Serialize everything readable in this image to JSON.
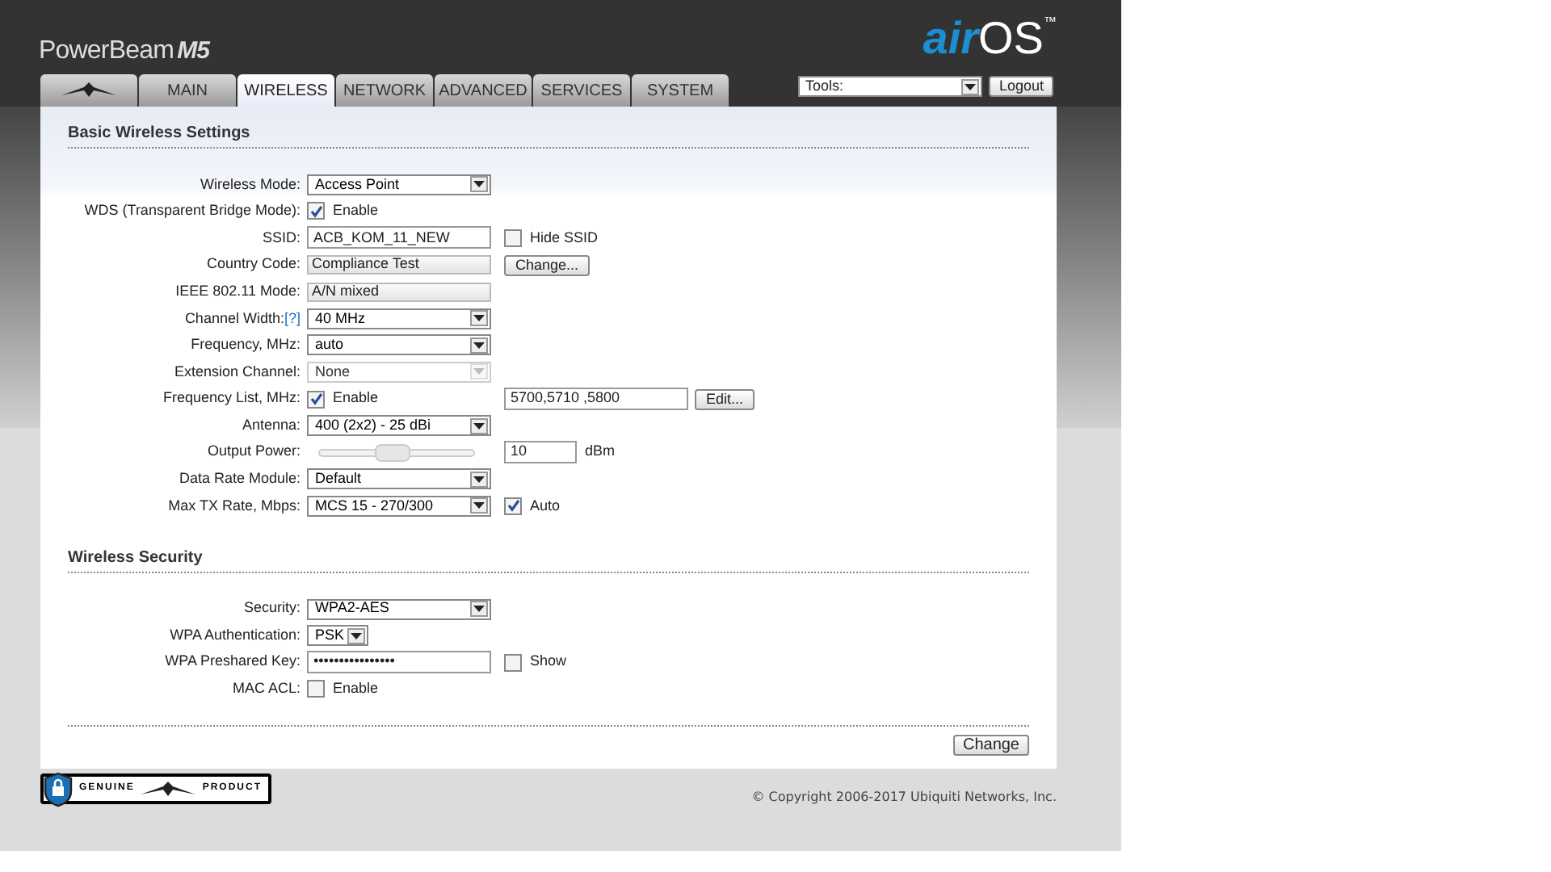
{
  "header": {
    "product": "PowerBeam",
    "model": "M5",
    "brand_left": "air",
    "brand_right": "OS",
    "tm": "™"
  },
  "tabs": [
    {
      "kind": "logo",
      "selected": false
    },
    {
      "label": "MAIN",
      "selected": false
    },
    {
      "label": "WIRELESS",
      "selected": true
    },
    {
      "label": "NETWORK",
      "selected": false
    },
    {
      "label": "ADVANCED",
      "selected": false
    },
    {
      "label": "SERVICES",
      "selected": false
    },
    {
      "label": "SYSTEM",
      "selected": false
    }
  ],
  "tools": {
    "value": "Tools:"
  },
  "logout": "Logout",
  "sections": [
    {
      "title": "Basic Wireless Settings",
      "rows": [
        {
          "label": "Wireless Mode:",
          "controls": [
            {
              "kind": "select",
              "value": "Access Point",
              "disabled": false
            }
          ]
        },
        {
          "label": "WDS (Transparent Bridge Mode):",
          "controls": [
            {
              "kind": "checkbox",
              "label": "Enable",
              "checked": true
            }
          ]
        },
        {
          "label": "SSID:",
          "controls": [
            {
              "kind": "text",
              "value": "ACB_KOM_11_NEW"
            },
            {
              "kind": "checkbox",
              "label": "Hide SSID",
              "checked": false
            }
          ]
        },
        {
          "label": "Country Code:",
          "controls": [
            {
              "kind": "readonly",
              "value": "Compliance Test"
            },
            {
              "kind": "button",
              "label": "Change..."
            }
          ]
        },
        {
          "label": "IEEE 802.11 Mode:",
          "controls": [
            {
              "kind": "readonly",
              "value": "A/N mixed"
            }
          ]
        },
        {
          "label": "Channel Width:",
          "help": "[?]",
          "controls": [
            {
              "kind": "select",
              "value": "40 MHz",
              "disabled": false
            }
          ]
        },
        {
          "label": "Frequency, MHz:",
          "controls": [
            {
              "kind": "select",
              "value": "auto",
              "disabled": false
            }
          ]
        },
        {
          "label": "Extension Channel:",
          "controls": [
            {
              "kind": "select",
              "value": "None",
              "disabled": true
            }
          ]
        },
        {
          "label": "Frequency List, MHz:",
          "controls": [
            {
              "kind": "checkbox",
              "label": "Enable",
              "checked": true
            },
            {
              "kind": "text",
              "value": "5700,5710 ,5800"
            },
            {
              "kind": "button",
              "label": "Edit..."
            }
          ]
        },
        {
          "label": "Antenna:",
          "controls": [
            {
              "kind": "select",
              "value": "400 (2x2) - 25 dBi",
              "disabled": false
            }
          ]
        },
        {
          "label": "Output Power:",
          "controls": [
            {
              "kind": "slider",
              "level": 0.45
            },
            {
              "kind": "number",
              "value": "10"
            },
            {
              "kind": "unit",
              "value": "dBm"
            }
          ]
        },
        {
          "label": "Data Rate Module:",
          "controls": [
            {
              "kind": "select",
              "value": "Default",
              "disabled": false
            }
          ]
        },
        {
          "label": "Max TX Rate, Mbps:",
          "controls": [
            {
              "kind": "select",
              "value": "MCS 15 - 270/300",
              "disabled": false
            },
            {
              "kind": "checkbox",
              "label": "Auto",
              "checked": true
            }
          ]
        }
      ]
    },
    {
      "title": "Wireless Security",
      "rows": [
        {
          "label": "Security:",
          "controls": [
            {
              "kind": "select",
              "value": "WPA2-AES",
              "disabled": false
            }
          ]
        },
        {
          "label": "WPA Authentication:",
          "controls": [
            {
              "kind": "compact-select",
              "value": "PSK",
              "disabled": false
            }
          ]
        },
        {
          "label": "WPA Preshared Key:",
          "controls": [
            {
              "kind": "text",
              "value": "••••••••••••••••"
            },
            {
              "kind": "checkbox",
              "label": "Show",
              "checked": false
            }
          ]
        },
        {
          "label": "MAC ACL:",
          "controls": [
            {
              "kind": "checkbox",
              "label": "Enable",
              "checked": false
            }
          ]
        }
      ]
    }
  ],
  "change_button": "Change",
  "footer": {
    "badge_left": "GENUINE",
    "badge_right": "PRODUCT",
    "copyright": "© Copyright 2006-2017 Ubiquiti Networks, Inc."
  }
}
